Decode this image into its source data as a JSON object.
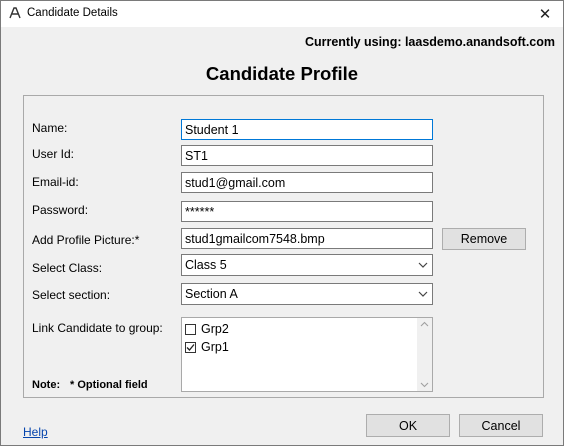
{
  "window": {
    "title": "Candidate Details",
    "close_glyph": "✕"
  },
  "header": {
    "server": "Currently using: laasdemo.anandsoft.com",
    "heading": "Candidate Profile"
  },
  "form": {
    "name_label": "Name:",
    "name_value": "Student 1",
    "userid_label": "User Id:",
    "userid_value": "ST1",
    "email_label": "Email-id:",
    "email_value": "stud1@gmail.com",
    "password_label": "Password:",
    "password_value": "******",
    "picture_label": "Add Profile Picture:*",
    "picture_value": "stud1gmailcom7548.bmp",
    "remove_label": "Remove",
    "class_label": "Select Class:",
    "class_value": "Class 5",
    "section_label": "Select section:",
    "section_value": "Section A",
    "group_label": "Link Candidate to group:",
    "groups": [
      {
        "label": "Grp2",
        "checked": false
      },
      {
        "label": "Grp1",
        "checked": true
      }
    ]
  },
  "note": {
    "label": "Note:",
    "text": "* Optional field"
  },
  "footer": {
    "ok_label": "OK",
    "cancel_label": "Cancel",
    "help_label": "Help"
  },
  "icons": {
    "app": "app-logo-icon",
    "close": "close-icon",
    "dropdown": "chevron-down-icon",
    "check": "checkmark-icon"
  },
  "colors": {
    "focus_border": "#0078d7",
    "link": "#0645ad"
  }
}
